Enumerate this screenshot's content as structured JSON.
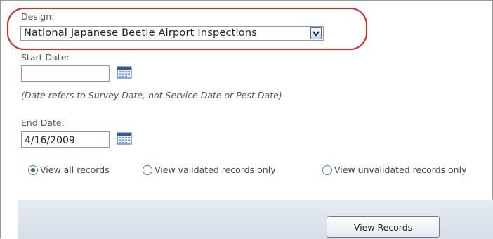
{
  "design": {
    "label": "Design:",
    "selected": "National Japanese Beetle Airport Inspections"
  },
  "start_date": {
    "label": "Start Date:",
    "value": ""
  },
  "note": "(Date refers to Survey Date, not Service Date or Pest Date)",
  "end_date": {
    "label": "End Date:",
    "value": "4/16/2009"
  },
  "filters": [
    {
      "label": "View all records",
      "selected": true
    },
    {
      "label": "View validated records only",
      "selected": false
    },
    {
      "label": "View unvalidated records only",
      "selected": false
    }
  ],
  "actions": {
    "view_records": "View Records"
  },
  "icons": {
    "calendar": "calendar-icon",
    "dropdown": "chevron-down-icon"
  },
  "colors": {
    "highlight": "#d12a2a",
    "radio_selected": "#2a8a2a"
  }
}
